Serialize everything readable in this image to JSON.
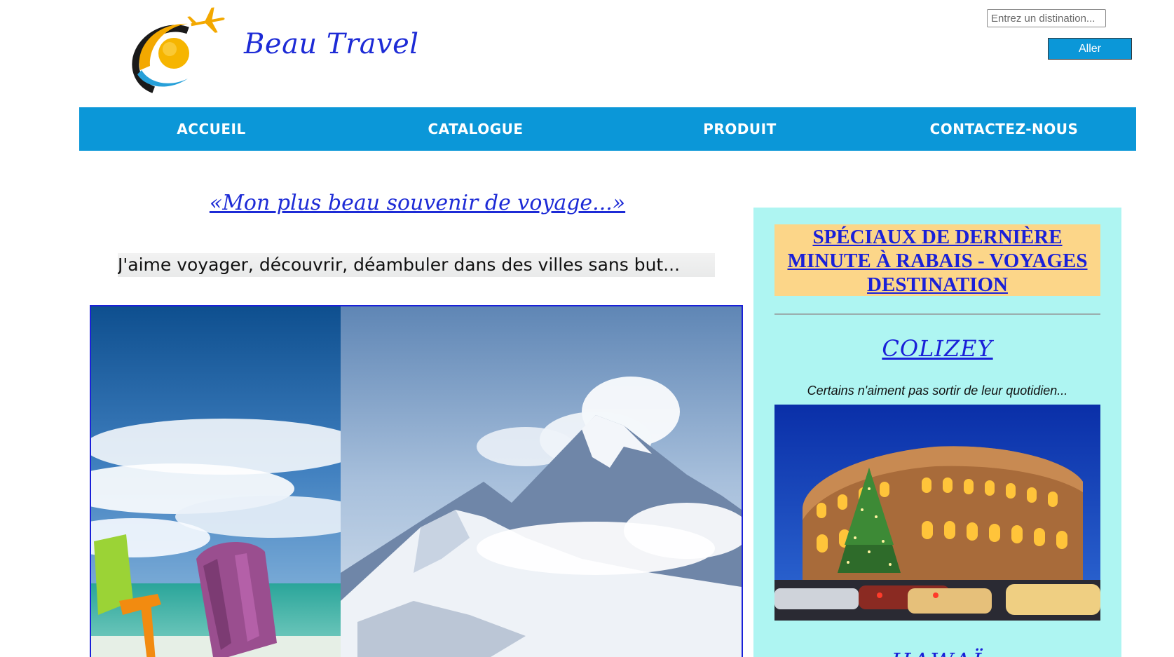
{
  "header": {
    "brand_name": "Beau Travel",
    "search": {
      "placeholder": "Entrez un distination...",
      "value": ""
    },
    "go_label": "Aller"
  },
  "nav": {
    "items": [
      {
        "label": "ACCUEIL"
      },
      {
        "label": "CATALOGUE"
      },
      {
        "label": "PRODUIT"
      },
      {
        "label": "CONTACTEZ-NOUS"
      }
    ]
  },
  "main": {
    "title": "«Mon plus beau souvenir de voyage...»",
    "lead": "J'aime voyager, découvrir, déambuler dans des villes sans but..."
  },
  "sidebar": {
    "promo": "SPÉCIAUX DE DERNIÈRE MINUTE À RABAIS - VOYAGES DESTINATION",
    "destination_1": {
      "title": "COLIZEY",
      "caption": "Certains n'aiment pas sortir de leur quotidien..."
    },
    "destination_2": {
      "title": "HAWAÏ"
    }
  },
  "colors": {
    "nav_bg": "#0b97d8",
    "brand": "#1d2bd6",
    "sidebar_bg": "#aef5f2",
    "promo_bg": "#fcd689",
    "link": "#1a20d8"
  },
  "icons": {
    "logo": "plane-sun-logo-icon"
  }
}
